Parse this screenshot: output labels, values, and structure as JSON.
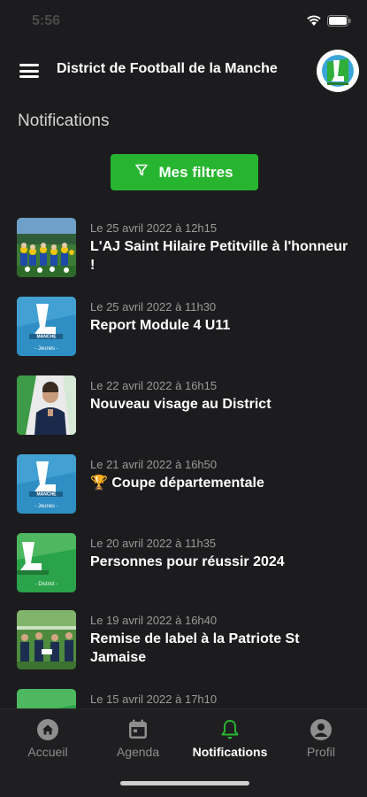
{
  "status_bar": {
    "time": "5:56"
  },
  "header": {
    "title": "District de Football de la Manche"
  },
  "page": {
    "title": "Notifications"
  },
  "filter_button": {
    "label": "Mes filtres"
  },
  "notifications": [
    {
      "date": "Le 25 avril 2022 à 12h15",
      "title": "L'AJ Saint Hilaire Petitville à l'honneur !",
      "thumb": "team-photo"
    },
    {
      "date": "Le 25 avril 2022 à 11h30",
      "title": "Report Module 4 U11",
      "thumb": "district-logo-blue",
      "thumb_caption": "- Jeunes -"
    },
    {
      "date": "Le 22 avril 2022 à 16h15",
      "title": "Nouveau visage au District",
      "thumb": "portrait"
    },
    {
      "date": "Le 21 avril 2022 à 16h50",
      "title": "🏆 Coupe départementale",
      "thumb": "district-logo-blue",
      "thumb_caption": "- Jeunes -"
    },
    {
      "date": "Le 20 avril 2022 à 11h35",
      "title": "Personnes pour réussir 2024",
      "thumb": "district-logo-green",
      "thumb_caption": "- District -"
    },
    {
      "date": "Le 19 avril 2022 à 16h40",
      "title": "Remise de label à la Patriote St Jamaise",
      "thumb": "ceremony-photo"
    },
    {
      "date": "Le 15 avril 2022 à 17h10",
      "title": "",
      "thumb": "district-logo-green"
    }
  ],
  "tabs": [
    {
      "label": "Accueil",
      "icon": "home-icon",
      "active": false
    },
    {
      "label": "Agenda",
      "icon": "calendar-icon",
      "active": false
    },
    {
      "label": "Notifications",
      "icon": "bell-icon",
      "active": true
    },
    {
      "label": "Profil",
      "icon": "profile-icon",
      "active": false
    }
  ],
  "colors": {
    "accent": "#27b530",
    "background": "#1c1c1e",
    "tab_active": "#27b530"
  }
}
